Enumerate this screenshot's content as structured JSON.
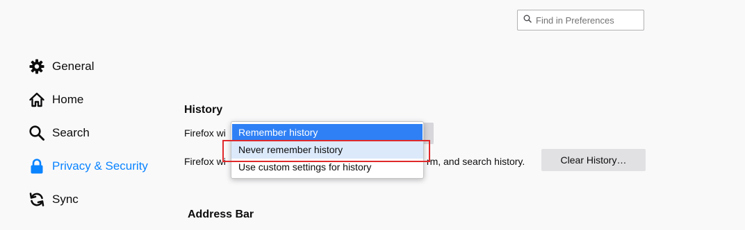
{
  "search": {
    "placeholder": "Find in Preferences"
  },
  "sidebar": {
    "items": [
      {
        "label": "General",
        "icon": "gear-icon",
        "selected": false
      },
      {
        "label": "Home",
        "icon": "home-icon",
        "selected": false
      },
      {
        "label": "Search",
        "icon": "search-icon",
        "selected": false
      },
      {
        "label": "Privacy & Security",
        "icon": "lock-icon",
        "selected": true
      },
      {
        "label": "Sync",
        "icon": "sync-icon",
        "selected": false
      }
    ]
  },
  "history": {
    "title": "History",
    "firefox_will_label": "Firefox wi",
    "desc_prefix": "Firefox wi",
    "desc_suffix": "rm, and search history.",
    "clear_button": "Clear History…",
    "dropdown": {
      "options": [
        {
          "label": "Remember history",
          "state": "selected"
        },
        {
          "label": "Never remember history",
          "state": "hover"
        },
        {
          "label": "Use custom settings for history",
          "state": "normal"
        }
      ]
    }
  },
  "address_bar": {
    "title": "Address Bar"
  },
  "colors": {
    "accent": "#0a84ff",
    "selected_option": "#2f80f5",
    "highlight_box": "#e0282a"
  }
}
